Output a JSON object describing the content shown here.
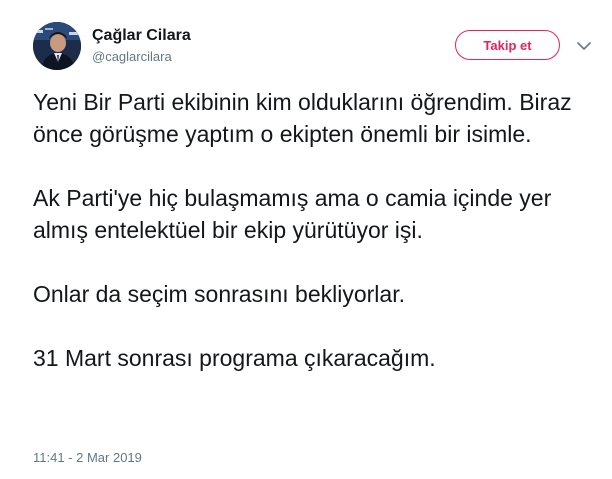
{
  "author": {
    "display_name": "Çağlar Cilara",
    "handle": "@caglarcilara",
    "avatar_icon": "avatar-photo"
  },
  "actions": {
    "follow_label": "Takip et",
    "follow_color": "#e0245e",
    "menu_icon": "chevron-down-icon"
  },
  "tweet": {
    "paragraphs": [
      "Yeni Bir Parti ekibinin kim olduklarını öğrendim. Biraz önce görüşme yaptım o ekipten önemli bir isimle.",
      "Ak Parti'ye hiç bulaşmamış ama o camia içinde yer almış entelektüel bir ekip yürütüyor işi.",
      "Onlar da seçim sonrasını bekliyorlar.",
      "31 Mart sonrası programa çıkaracağım."
    ],
    "timestamp": "11:41 - 2 Mar 2019"
  },
  "colors": {
    "text": "#14171a",
    "secondary": "#657786",
    "accent": "#e0245e"
  }
}
